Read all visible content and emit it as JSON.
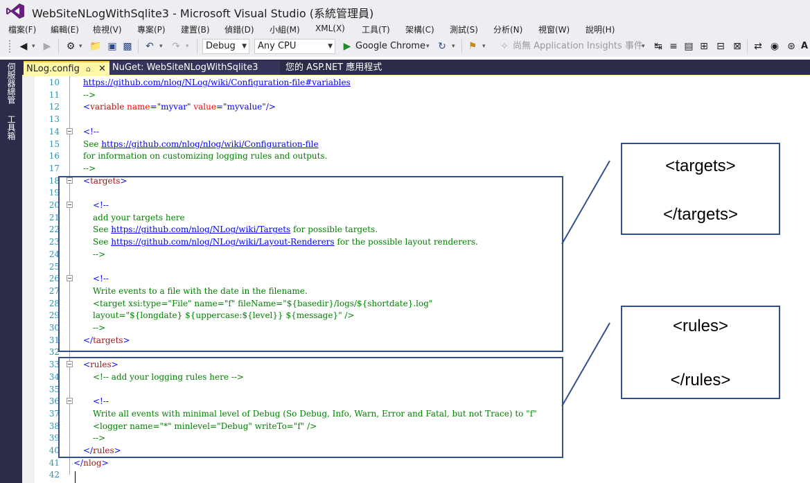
{
  "window": {
    "title": "WebSiteNLogWithSqlite3 - Microsoft Visual Studio (系統管理員)"
  },
  "menu": [
    "檔案(F)",
    "編輯(E)",
    "檢視(V)",
    "專案(P)",
    "建置(B)",
    "偵錯(D)",
    "小組(M)",
    "XML(X)",
    "工具(T)",
    "架構(C)",
    "測試(S)",
    "分析(N)",
    "視窗(W)",
    "說明(H)"
  ],
  "toolbar": {
    "config": "Debug",
    "platform": "Any CPU",
    "browser": "Google Chrome",
    "app_insights": "尚無 Application Insights 事件",
    "trailing": "A"
  },
  "side_panels": [
    "伺服器總管",
    "工具箱"
  ],
  "tabs": [
    {
      "label": "NLog.config",
      "active": true
    },
    {
      "label": "NuGet: WebSiteNLogWithSqlite3",
      "active": false
    },
    {
      "label": "您的 ASP.NET 應用程式",
      "active": false
    }
  ],
  "code_lines": [
    {
      "n": "10",
      "parts": [
        {
          "t": "url",
          "s": "https://github.com/nlog/NLog/wiki/Configuration-file#variables"
        }
      ]
    },
    {
      "n": "11",
      "parts": [
        {
          "t": "cmt",
          "s": " -->"
        }
      ]
    },
    {
      "n": "12",
      "parts": [
        {
          "t": "br",
          "s": "<"
        },
        {
          "t": "tag",
          "s": "variable"
        },
        {
          "t": "attr",
          "s": " name"
        },
        {
          "t": "br",
          "s": "="
        },
        {
          "t": "txt",
          "s": "\""
        },
        {
          "t": "val",
          "s": "myvar"
        },
        {
          "t": "txt",
          "s": "\""
        },
        {
          "t": "attr",
          "s": " value"
        },
        {
          "t": "br",
          "s": "="
        },
        {
          "t": "txt",
          "s": "\""
        },
        {
          "t": "val",
          "s": "myvalue"
        },
        {
          "t": "txt",
          "s": "\""
        },
        {
          "t": "br",
          "s": "/>"
        }
      ]
    },
    {
      "n": "13",
      "parts": []
    },
    {
      "n": "14",
      "fold": true,
      "parts": [
        {
          "t": "br",
          "s": "<!--"
        }
      ]
    },
    {
      "n": "15",
      "parts": [
        {
          "t": "cmt",
          "s": "See "
        },
        {
          "t": "url",
          "s": "https://github.com/nlog/nlog/wiki/Configuration-file"
        }
      ]
    },
    {
      "n": "16",
      "parts": [
        {
          "t": "cmt",
          "s": "for information on customizing logging rules and outputs."
        }
      ]
    },
    {
      "n": "17",
      "parts": [
        {
          "t": "cmt",
          "s": " -->"
        }
      ]
    },
    {
      "n": "18",
      "fold": true,
      "parts": [
        {
          "t": "br",
          "s": "<"
        },
        {
          "t": "tag",
          "s": "targets"
        },
        {
          "t": "br",
          "s": ">"
        }
      ]
    },
    {
      "n": "19",
      "parts": []
    },
    {
      "n": "20",
      "fold": true,
      "indent": 2,
      "parts": [
        {
          "t": "br",
          "s": "<!--"
        }
      ]
    },
    {
      "n": "21",
      "indent": 2,
      "parts": [
        {
          "t": "cmt",
          "s": "add your targets here"
        }
      ]
    },
    {
      "n": "22",
      "indent": 2,
      "parts": [
        {
          "t": "cmt",
          "s": "See "
        },
        {
          "t": "url",
          "s": "https://github.com/nlog/NLog/wiki/Targets"
        },
        {
          "t": "cmt",
          "s": " for possible targets."
        }
      ]
    },
    {
      "n": "23",
      "indent": 2,
      "parts": [
        {
          "t": "cmt",
          "s": "See "
        },
        {
          "t": "url",
          "s": "https://github.com/nlog/NLog/wiki/Layout-Renderers"
        },
        {
          "t": "cmt",
          "s": " for the possible layout renderers."
        }
      ]
    },
    {
      "n": "24",
      "indent": 2,
      "parts": [
        {
          "t": "cmt",
          "s": "-->"
        }
      ]
    },
    {
      "n": "25",
      "parts": []
    },
    {
      "n": "26",
      "fold": true,
      "indent": 2,
      "parts": [
        {
          "t": "br",
          "s": "<!--"
        }
      ]
    },
    {
      "n": "27",
      "indent": 2,
      "parts": [
        {
          "t": "cmt",
          "s": "Write events to a file with the date in the filename."
        }
      ]
    },
    {
      "n": "28",
      "indent": 2,
      "parts": [
        {
          "t": "cmt",
          "s": "<target xsi:type=\"File\" name=\"f\" fileName=\"${basedir}/logs/${shortdate}.log\""
        }
      ]
    },
    {
      "n": "29",
      "indent": 2,
      "parts": [
        {
          "t": "cmt",
          "s": "        layout=\"${longdate} ${uppercase:${level}} ${message}\" />"
        }
      ]
    },
    {
      "n": "30",
      "indent": 2,
      "parts": [
        {
          "t": "cmt",
          "s": "-->"
        }
      ]
    },
    {
      "n": "31",
      "parts": [
        {
          "t": "br",
          "s": "</"
        },
        {
          "t": "tag",
          "s": "targets"
        },
        {
          "t": "br",
          "s": ">"
        }
      ]
    },
    {
      "n": "32",
      "parts": []
    },
    {
      "n": "33",
      "fold": true,
      "parts": [
        {
          "t": "br",
          "s": "<"
        },
        {
          "t": "tag",
          "s": "rules"
        },
        {
          "t": "br",
          "s": ">"
        }
      ]
    },
    {
      "n": "34",
      "indent": 2,
      "parts": [
        {
          "t": "cmt",
          "s": "<!-- add your logging rules here -->"
        }
      ]
    },
    {
      "n": "35",
      "parts": []
    },
    {
      "n": "36",
      "fold": true,
      "indent": 2,
      "parts": [
        {
          "t": "br",
          "s": "<!--"
        }
      ]
    },
    {
      "n": "37",
      "indent": 2,
      "parts": [
        {
          "t": "cmt",
          "s": "Write all events with minimal level of Debug (So Debug, Info, Warn, Error and Fatal, but not Trace)  to \"f\""
        }
      ]
    },
    {
      "n": "38",
      "indent": 2,
      "parts": [
        {
          "t": "cmt",
          "s": "<logger name=\"*\" minlevel=\"Debug\" writeTo=\"f\" />"
        }
      ]
    },
    {
      "n": "39",
      "indent": 2,
      "parts": [
        {
          "t": "cmt",
          "s": "-->"
        }
      ]
    },
    {
      "n": "40",
      "parts": [
        {
          "t": "br",
          "s": "</"
        },
        {
          "t": "tag",
          "s": "rules"
        },
        {
          "t": "br",
          "s": ">"
        }
      ]
    },
    {
      "n": "41",
      "outdent": true,
      "parts": [
        {
          "t": "br",
          "s": "</"
        },
        {
          "t": "tag",
          "s": "nlog"
        },
        {
          "t": "br",
          "s": ">"
        }
      ]
    },
    {
      "n": "42",
      "parts": []
    }
  ],
  "callouts": {
    "targets": {
      "open": "<targets>",
      "close": "</targets>"
    },
    "rules": {
      "open": "<rules>",
      "close": "</rules>"
    }
  },
  "colors": {
    "annotation_border": "#2f4f8f",
    "active_tab": "#fff7a8",
    "line_numbers": "#2b91af",
    "comment": "#008000",
    "xml_tag": "#a31515"
  }
}
